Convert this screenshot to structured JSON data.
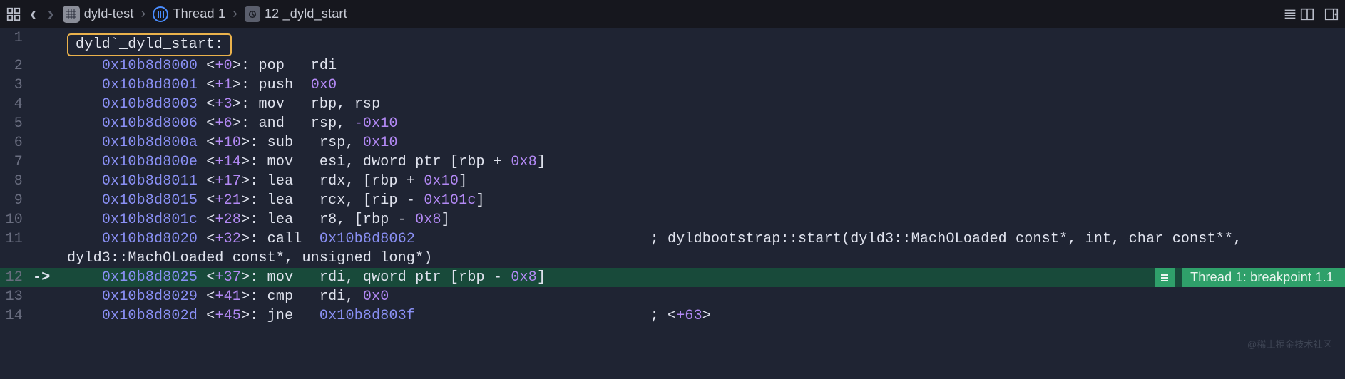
{
  "toolbar": {
    "back_enabled": true,
    "fwd_enabled": false,
    "crumbs": [
      {
        "icon": "app",
        "label": "dyld-test"
      },
      {
        "icon": "thread",
        "label": "Thread 1"
      },
      {
        "icon": "frame",
        "label": "12 _dyld_start"
      }
    ]
  },
  "editor": {
    "function_label": "dyld`_dyld_start:",
    "rows": [
      {
        "ln": 1,
        "type": "label"
      },
      {
        "ln": 2,
        "type": "ins",
        "addr": "0x10b8d8000",
        "off": "+0",
        "mn": "pop",
        "ops": [
          {
            "k": "reg",
            "v": "rdi"
          }
        ]
      },
      {
        "ln": 3,
        "type": "ins",
        "addr": "0x10b8d8001",
        "off": "+1",
        "mn": "push",
        "ops": [
          {
            "k": "num",
            "v": "0x0"
          }
        ]
      },
      {
        "ln": 4,
        "type": "ins",
        "addr": "0x10b8d8003",
        "off": "+3",
        "mn": "mov",
        "ops": [
          {
            "k": "reg",
            "v": "rbp"
          },
          {
            "k": "txt",
            "v": ", "
          },
          {
            "k": "reg",
            "v": "rsp"
          }
        ]
      },
      {
        "ln": 5,
        "type": "ins",
        "addr": "0x10b8d8006",
        "off": "+6",
        "mn": "and",
        "ops": [
          {
            "k": "reg",
            "v": "rsp"
          },
          {
            "k": "txt",
            "v": ", "
          },
          {
            "k": "num",
            "v": "-0x10"
          }
        ]
      },
      {
        "ln": 6,
        "type": "ins",
        "addr": "0x10b8d800a",
        "off": "+10",
        "mn": "sub",
        "ops": [
          {
            "k": "reg",
            "v": "rsp"
          },
          {
            "k": "txt",
            "v": ", "
          },
          {
            "k": "num",
            "v": "0x10"
          }
        ]
      },
      {
        "ln": 7,
        "type": "ins",
        "addr": "0x10b8d800e",
        "off": "+14",
        "mn": "mov",
        "ops": [
          {
            "k": "reg",
            "v": "esi"
          },
          {
            "k": "txt",
            "v": ", dword ptr [rbp + "
          },
          {
            "k": "num",
            "v": "0x8"
          },
          {
            "k": "txt",
            "v": "]"
          }
        ]
      },
      {
        "ln": 8,
        "type": "ins",
        "addr": "0x10b8d8011",
        "off": "+17",
        "mn": "lea",
        "ops": [
          {
            "k": "reg",
            "v": "rdx"
          },
          {
            "k": "txt",
            "v": ", [rbp + "
          },
          {
            "k": "num",
            "v": "0x10"
          },
          {
            "k": "txt",
            "v": "]"
          }
        ]
      },
      {
        "ln": 9,
        "type": "ins",
        "addr": "0x10b8d8015",
        "off": "+21",
        "mn": "lea",
        "ops": [
          {
            "k": "reg",
            "v": "rcx"
          },
          {
            "k": "txt",
            "v": ", [rip - "
          },
          {
            "k": "num",
            "v": "0x101c"
          },
          {
            "k": "txt",
            "v": "]"
          }
        ]
      },
      {
        "ln": 10,
        "type": "ins",
        "addr": "0x10b8d801c",
        "off": "+28",
        "mn": "lea",
        "ops": [
          {
            "k": "reg",
            "v": "r8"
          },
          {
            "k": "txt",
            "v": ", [rbp - "
          },
          {
            "k": "num",
            "v": "0x8"
          },
          {
            "k": "txt",
            "v": "]"
          }
        ]
      },
      {
        "ln": 11,
        "type": "ins",
        "addr": "0x10b8d8020",
        "off": "+32",
        "mn": "call",
        "ops": [
          {
            "k": "addr",
            "v": "0x10b8d8062"
          }
        ],
        "comment_col": 63,
        "comment": "; dyldbootstrap::start(dyld3::MachOLoaded const*, int, char const**, dyld3::MachOLoaded const*, unsigned long*)"
      },
      {
        "ln": 12,
        "type": "ins",
        "hl": true,
        "arrow": "->",
        "addr": "0x10b8d8025",
        "off": "+37",
        "mn": "mov",
        "ops": [
          {
            "k": "reg",
            "v": "rdi"
          },
          {
            "k": "txt",
            "v": ", qword ptr [rbp - "
          },
          {
            "k": "num",
            "v": "0x8"
          },
          {
            "k": "txt",
            "v": "]"
          }
        ],
        "badge": "Thread 1: breakpoint 1.1"
      },
      {
        "ln": 13,
        "type": "ins",
        "addr": "0x10b8d8029",
        "off": "+41",
        "mn": "cmp",
        "ops": [
          {
            "k": "reg",
            "v": "rdi"
          },
          {
            "k": "txt",
            "v": ", "
          },
          {
            "k": "num",
            "v": "0x0"
          }
        ]
      },
      {
        "ln": 14,
        "type": "ins",
        "addr": "0x10b8d802d",
        "off": "+45",
        "mn": "jne",
        "ops": [
          {
            "k": "addr",
            "v": "0x10b8d803f"
          }
        ],
        "comment_col": 63,
        "comment": "; <+63>",
        "comment_offset": true
      }
    ]
  },
  "watermark": "@稀土掘金技术社区"
}
